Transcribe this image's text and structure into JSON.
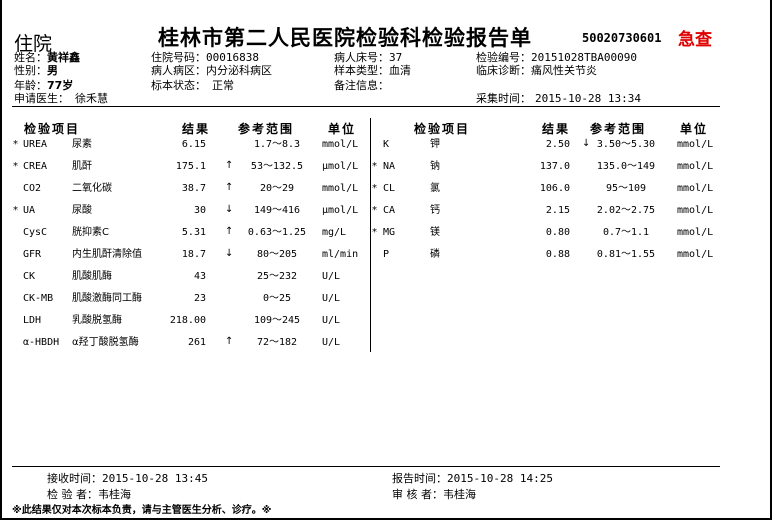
{
  "header": {
    "hospitalization_type": "住院",
    "title": "桂林市第二人民医院检验科检验报告单",
    "report_no": "50020730601",
    "urgent": "急查"
  },
  "patient": {
    "name_label": "姓名：",
    "name": "黄祥鑫",
    "sex_label": "性别：",
    "sex": "男",
    "age_label": "年龄：",
    "age": "77岁",
    "doctor_label": "申请医生：",
    "doctor": "徐禾慧",
    "inpatient_no_label": "住院号码：",
    "inpatient_no": "00016838",
    "ward_label": "病人病区：",
    "ward": "内分泌科病区",
    "status_label": "标本状态：",
    "status": "正常",
    "bed_label": "病人床号：",
    "bed": "37",
    "sample_label": "样本类型：",
    "sample": "血清",
    "remark_label": "备注信息：",
    "remark": "",
    "test_no_label": "检验编号：",
    "test_no": "20151028TBA00090",
    "diagnosis_label": "临床诊断：",
    "diagnosis": "痛风性关节炎",
    "collect_label": "采集时间：",
    "collect_time": "2015-10-28 13:34"
  },
  "table_headers": {
    "item": "检验项目",
    "result": "结果",
    "range": "参考范围",
    "unit": "单位"
  },
  "left_rows": [
    {
      "mark": "*",
      "code": "UREA",
      "name": "尿素",
      "result": "6.15",
      "flag": "",
      "range": "1.7～8.3",
      "unit": "mmol/L"
    },
    {
      "mark": "*",
      "code": "CREA",
      "name": "肌酐",
      "result": "175.1",
      "flag": "↑",
      "range": "53～132.5",
      "unit": "μmol/L"
    },
    {
      "mark": "",
      "code": "CO2",
      "name": "二氧化碳",
      "result": "38.7",
      "flag": "↑",
      "range": "20～29",
      "unit": "mmol/L"
    },
    {
      "mark": "*",
      "code": "UA",
      "name": "尿酸",
      "result": "30",
      "flag": "↓",
      "range": "149～416",
      "unit": "μmol/L"
    },
    {
      "mark": "",
      "code": "CysC",
      "name": "胱抑素C",
      "result": "5.31",
      "flag": "↑",
      "range": "0.63～1.25",
      "unit": "mg/L"
    },
    {
      "mark": "",
      "code": "GFR",
      "name": "内生肌酐清除值",
      "result": "18.7",
      "flag": "↓",
      "range": "80～205",
      "unit": "ml/min"
    },
    {
      "mark": "",
      "code": "CK",
      "name": "肌酸肌酶",
      "result": "43",
      "flag": "",
      "range": "25～232",
      "unit": "U/L"
    },
    {
      "mark": "",
      "code": "CK-MB",
      "name": "肌酸激酶同工酶",
      "result": "23",
      "flag": "",
      "range": "0～25",
      "unit": "U/L"
    },
    {
      "mark": "",
      "code": "LDH",
      "name": "乳酸脱氢酶",
      "result": "218.00",
      "flag": "",
      "range": "109～245",
      "unit": "U/L"
    },
    {
      "mark": "",
      "code": "α-HBDH",
      "name": "α羟丁酸脱氢酶",
      "result": "261",
      "flag": "↑",
      "range": "72～182",
      "unit": "U/L"
    }
  ],
  "right_rows": [
    {
      "mark": "",
      "code": "K",
      "name": "钾",
      "result": "2.50",
      "flag": "↓",
      "range": "3.50～5.30",
      "unit": "mmol/L"
    },
    {
      "mark": "*",
      "code": "NA",
      "name": "钠",
      "result": "137.0",
      "flag": "",
      "range": "135.0～149",
      "unit": "mmol/L"
    },
    {
      "mark": "*",
      "code": "CL",
      "name": "氯",
      "result": "106.0",
      "flag": "",
      "range": "95～109",
      "unit": "mmol/L"
    },
    {
      "mark": "*",
      "code": "CA",
      "name": "钙",
      "result": "2.15",
      "flag": "",
      "range": "2.02～2.75",
      "unit": "mmol/L"
    },
    {
      "mark": "*",
      "code": "MG",
      "name": "镁",
      "result": "0.80",
      "flag": "",
      "range": "0.7～1.1",
      "unit": "mmol/L"
    },
    {
      "mark": "",
      "code": "P",
      "name": "磷",
      "result": "0.88",
      "flag": "",
      "range": "0.81～1.55",
      "unit": "mmol/L"
    }
  ],
  "footer": {
    "receive_label": "接收时间：",
    "receive_time": "2015-10-28 13:45",
    "report_label": "报告时间：",
    "report_time": "2015-10-28 14:25",
    "tester_label": "检 验 者：",
    "tester": "韦桂海",
    "reviewer_label": "审 核 者：",
    "reviewer": "韦桂海",
    "note": "※此结果仅对本次标本负责，请与主管医生分析、诊疗。※"
  }
}
